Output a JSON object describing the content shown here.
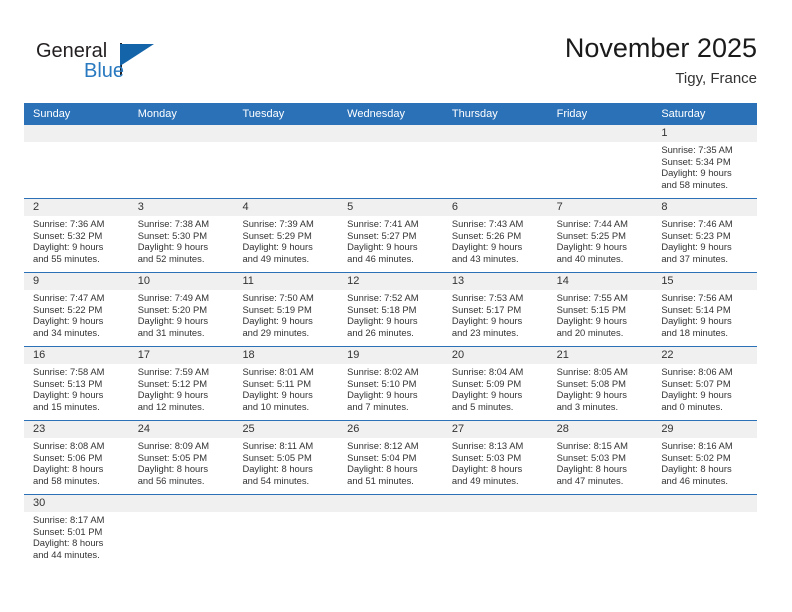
{
  "logo": {
    "word1": "General",
    "word2": "Blue",
    "triangle_color": "#1464aa",
    "blue_text_color": "#2879c0"
  },
  "header": {
    "title": "November 2025",
    "subtitle": "Tigy, France",
    "header_bg": "#2b71b8",
    "daynum_bg": "#f0f0f0"
  },
  "calendar": {
    "day_names": [
      "Sunday",
      "Monday",
      "Tuesday",
      "Wednesday",
      "Thursday",
      "Friday",
      "Saturday"
    ],
    "weeks": [
      [
        {
          "date": "",
          "lines": []
        },
        {
          "date": "",
          "lines": []
        },
        {
          "date": "",
          "lines": []
        },
        {
          "date": "",
          "lines": []
        },
        {
          "date": "",
          "lines": []
        },
        {
          "date": "",
          "lines": []
        },
        {
          "date": "1",
          "lines": [
            "Sunrise: 7:35 AM",
            "Sunset: 5:34 PM",
            "Daylight: 9 hours",
            "and 58 minutes."
          ]
        }
      ],
      [
        {
          "date": "2",
          "lines": [
            "Sunrise: 7:36 AM",
            "Sunset: 5:32 PM",
            "Daylight: 9 hours",
            "and 55 minutes."
          ]
        },
        {
          "date": "3",
          "lines": [
            "Sunrise: 7:38 AM",
            "Sunset: 5:30 PM",
            "Daylight: 9 hours",
            "and 52 minutes."
          ]
        },
        {
          "date": "4",
          "lines": [
            "Sunrise: 7:39 AM",
            "Sunset: 5:29 PM",
            "Daylight: 9 hours",
            "and 49 minutes."
          ]
        },
        {
          "date": "5",
          "lines": [
            "Sunrise: 7:41 AM",
            "Sunset: 5:27 PM",
            "Daylight: 9 hours",
            "and 46 minutes."
          ]
        },
        {
          "date": "6",
          "lines": [
            "Sunrise: 7:43 AM",
            "Sunset: 5:26 PM",
            "Daylight: 9 hours",
            "and 43 minutes."
          ]
        },
        {
          "date": "7",
          "lines": [
            "Sunrise: 7:44 AM",
            "Sunset: 5:25 PM",
            "Daylight: 9 hours",
            "and 40 minutes."
          ]
        },
        {
          "date": "8",
          "lines": [
            "Sunrise: 7:46 AM",
            "Sunset: 5:23 PM",
            "Daylight: 9 hours",
            "and 37 minutes."
          ]
        }
      ],
      [
        {
          "date": "9",
          "lines": [
            "Sunrise: 7:47 AM",
            "Sunset: 5:22 PM",
            "Daylight: 9 hours",
            "and 34 minutes."
          ]
        },
        {
          "date": "10",
          "lines": [
            "Sunrise: 7:49 AM",
            "Sunset: 5:20 PM",
            "Daylight: 9 hours",
            "and 31 minutes."
          ]
        },
        {
          "date": "11",
          "lines": [
            "Sunrise: 7:50 AM",
            "Sunset: 5:19 PM",
            "Daylight: 9 hours",
            "and 29 minutes."
          ]
        },
        {
          "date": "12",
          "lines": [
            "Sunrise: 7:52 AM",
            "Sunset: 5:18 PM",
            "Daylight: 9 hours",
            "and 26 minutes."
          ]
        },
        {
          "date": "13",
          "lines": [
            "Sunrise: 7:53 AM",
            "Sunset: 5:17 PM",
            "Daylight: 9 hours",
            "and 23 minutes."
          ]
        },
        {
          "date": "14",
          "lines": [
            "Sunrise: 7:55 AM",
            "Sunset: 5:15 PM",
            "Daylight: 9 hours",
            "and 20 minutes."
          ]
        },
        {
          "date": "15",
          "lines": [
            "Sunrise: 7:56 AM",
            "Sunset: 5:14 PM",
            "Daylight: 9 hours",
            "and 18 minutes."
          ]
        }
      ],
      [
        {
          "date": "16",
          "lines": [
            "Sunrise: 7:58 AM",
            "Sunset: 5:13 PM",
            "Daylight: 9 hours",
            "and 15 minutes."
          ]
        },
        {
          "date": "17",
          "lines": [
            "Sunrise: 7:59 AM",
            "Sunset: 5:12 PM",
            "Daylight: 9 hours",
            "and 12 minutes."
          ]
        },
        {
          "date": "18",
          "lines": [
            "Sunrise: 8:01 AM",
            "Sunset: 5:11 PM",
            "Daylight: 9 hours",
            "and 10 minutes."
          ]
        },
        {
          "date": "19",
          "lines": [
            "Sunrise: 8:02 AM",
            "Sunset: 5:10 PM",
            "Daylight: 9 hours",
            "and 7 minutes."
          ]
        },
        {
          "date": "20",
          "lines": [
            "Sunrise: 8:04 AM",
            "Sunset: 5:09 PM",
            "Daylight: 9 hours",
            "and 5 minutes."
          ]
        },
        {
          "date": "21",
          "lines": [
            "Sunrise: 8:05 AM",
            "Sunset: 5:08 PM",
            "Daylight: 9 hours",
            "and 3 minutes."
          ]
        },
        {
          "date": "22",
          "lines": [
            "Sunrise: 8:06 AM",
            "Sunset: 5:07 PM",
            "Daylight: 9 hours",
            "and 0 minutes."
          ]
        }
      ],
      [
        {
          "date": "23",
          "lines": [
            "Sunrise: 8:08 AM",
            "Sunset: 5:06 PM",
            "Daylight: 8 hours",
            "and 58 minutes."
          ]
        },
        {
          "date": "24",
          "lines": [
            "Sunrise: 8:09 AM",
            "Sunset: 5:05 PM",
            "Daylight: 8 hours",
            "and 56 minutes."
          ]
        },
        {
          "date": "25",
          "lines": [
            "Sunrise: 8:11 AM",
            "Sunset: 5:05 PM",
            "Daylight: 8 hours",
            "and 54 minutes."
          ]
        },
        {
          "date": "26",
          "lines": [
            "Sunrise: 8:12 AM",
            "Sunset: 5:04 PM",
            "Daylight: 8 hours",
            "and 51 minutes."
          ]
        },
        {
          "date": "27",
          "lines": [
            "Sunrise: 8:13 AM",
            "Sunset: 5:03 PM",
            "Daylight: 8 hours",
            "and 49 minutes."
          ]
        },
        {
          "date": "28",
          "lines": [
            "Sunrise: 8:15 AM",
            "Sunset: 5:03 PM",
            "Daylight: 8 hours",
            "and 47 minutes."
          ]
        },
        {
          "date": "29",
          "lines": [
            "Sunrise: 8:16 AM",
            "Sunset: 5:02 PM",
            "Daylight: 8 hours",
            "and 46 minutes."
          ]
        }
      ],
      [
        {
          "date": "30",
          "lines": [
            "Sunrise: 8:17 AM",
            "Sunset: 5:01 PM",
            "Daylight: 8 hours",
            "and 44 minutes."
          ]
        },
        {
          "date": "",
          "lines": []
        },
        {
          "date": "",
          "lines": []
        },
        {
          "date": "",
          "lines": []
        },
        {
          "date": "",
          "lines": []
        },
        {
          "date": "",
          "lines": []
        },
        {
          "date": "",
          "lines": []
        }
      ]
    ]
  }
}
